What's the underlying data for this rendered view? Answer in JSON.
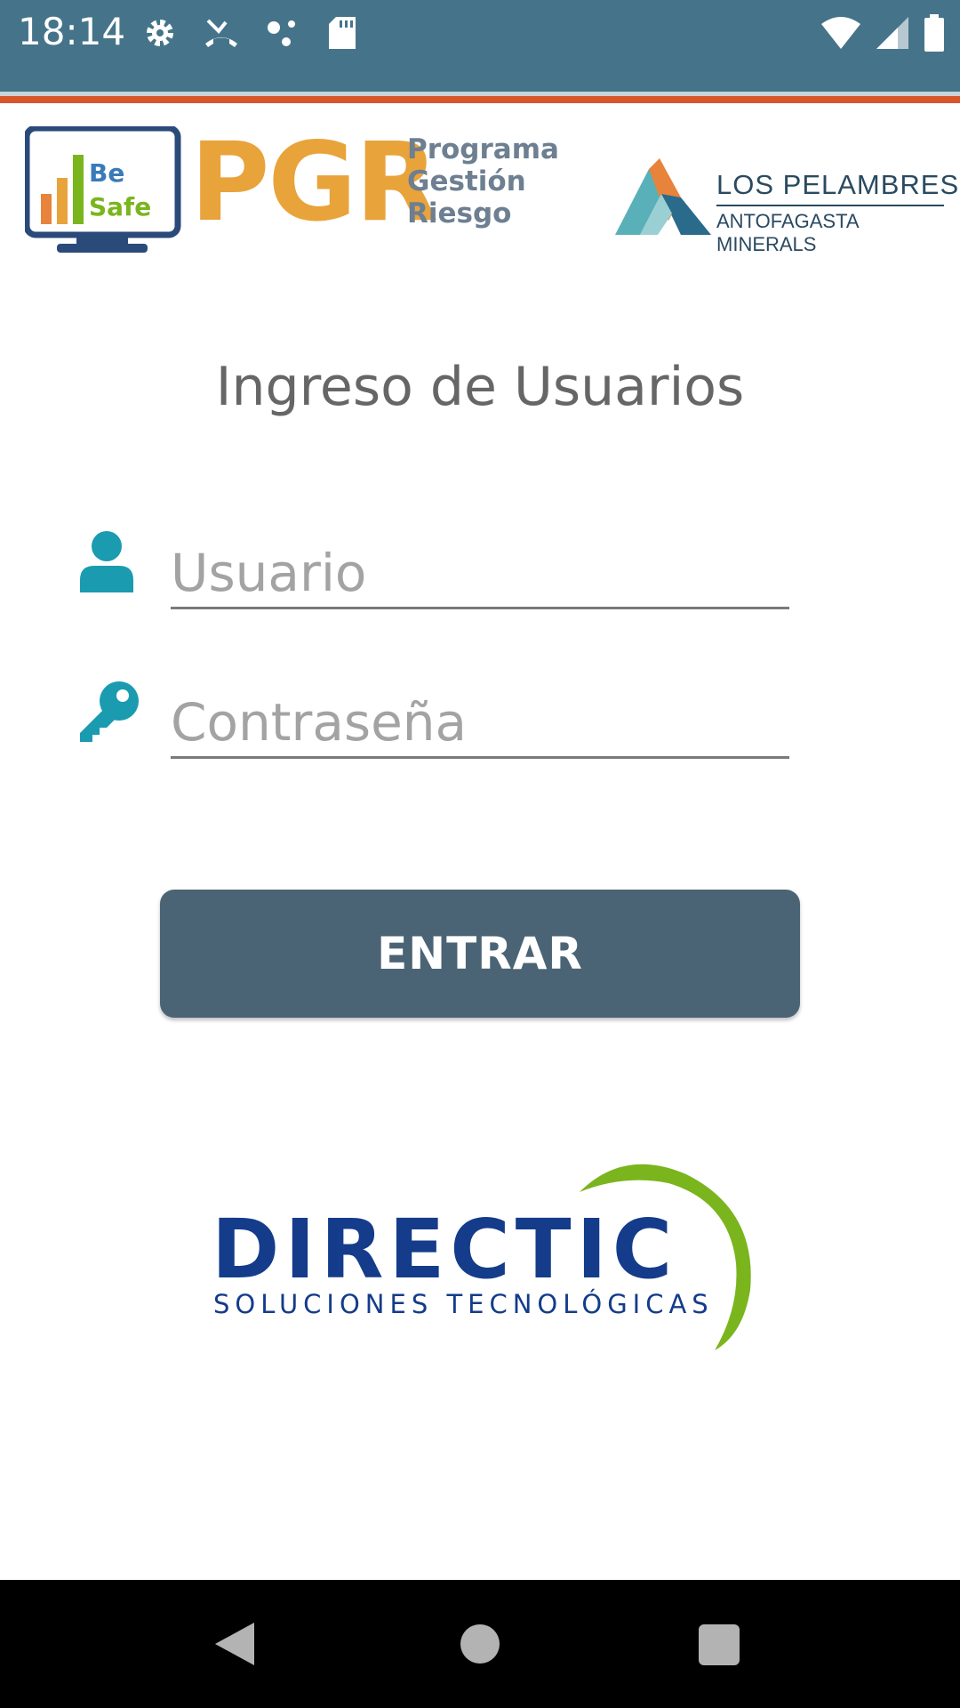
{
  "status_bar": {
    "time": "18:14",
    "icons_left": [
      "gear-icon",
      "missed-call-icon",
      "dots-icon",
      "sd-card-icon"
    ],
    "icons_right": [
      "wifi-icon",
      "signal-icon",
      "battery-icon"
    ]
  },
  "header": {
    "besafe_logo_text": "Be Safe",
    "pgr_title": "PGR",
    "pgr_subtitle_1": "Programa",
    "pgr_subtitle_2": "Gestión",
    "pgr_subtitle_3": "Riesgo",
    "partner_name": "LOS PELAMBRES",
    "partner_sub": "ANTOFAGASTA MINERALS"
  },
  "login": {
    "title": "Ingreso de Usuarios",
    "username": {
      "value": "",
      "placeholder": "Usuario"
    },
    "password": {
      "value": "",
      "placeholder": "Contraseña"
    },
    "submit_label": "ENTRAR"
  },
  "footer_logo": {
    "name": "DIRECTIC",
    "tagline": "SOLUCIONES TECNOLÓGICAS"
  },
  "colors": {
    "status_bar": "#45748a",
    "accent_orange": "#d8572a",
    "pgr_orange": "#e8a33b",
    "button": "#4b6475",
    "icon_teal": "#1a9bb0",
    "directic_blue": "#143c8a",
    "directic_green": "#7ab51d"
  }
}
